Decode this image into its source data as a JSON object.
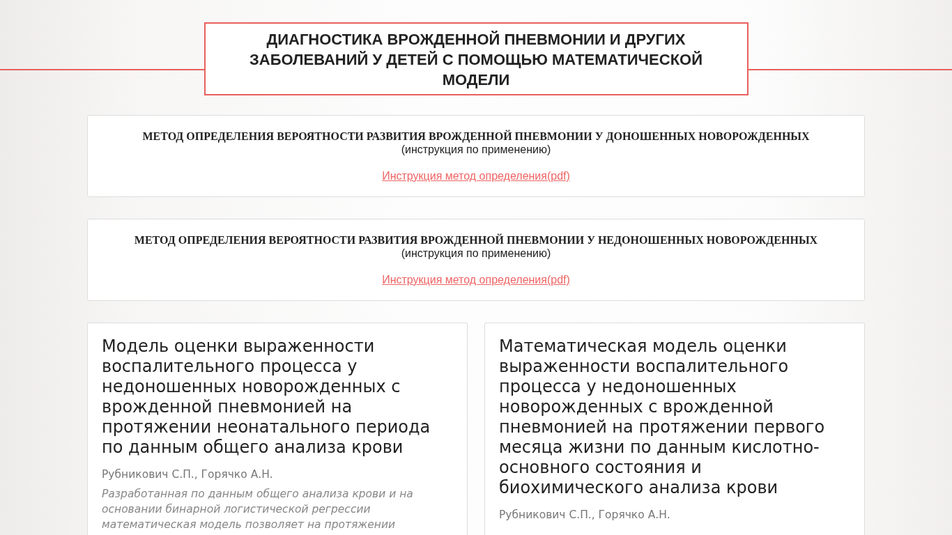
{
  "header": {
    "title": "ДИАГНОСТИКА ВРОЖДЕННОЙ ПНЕВМОНИИ И ДРУГИХ ЗАБОЛЕВАНИЙ У ДЕТЕЙ С ПОМОЩЬЮ МАТЕМАТИЧЕСКОЙ МОДЕЛИ"
  },
  "method_cards": [
    {
      "title": "МЕТОД ОПРЕДЕЛЕНИЯ ВЕРОЯТНОСТИ РАЗВИТИЯ ВРОЖДЕННОЙ ПНЕВМОНИИ У ДОНОШЕННЫХ НОВОРОЖДЕННЫХ",
      "subtitle": "(инструкция по применению)",
      "link": "Инструкция метод определения(pdf)"
    },
    {
      "title": "МЕТОД ОПРЕДЕЛЕНИЯ ВЕРОЯТНОСТИ РАЗВИТИЯ ВРОЖДЕННОЙ ПНЕВМОНИИ У НЕДОНОШЕННЫХ НОВОРОЖДЕННЫХ",
      "subtitle": "(инструкция по применению)",
      "link": "Инструкция метод определения(pdf)"
    }
  ],
  "model_cards": [
    {
      "title": "Модель оценки выраженности воспалительного процесса у недоношенных новорожденных с врожденной пневмонией на протяжении неонатального периода по данным общего анализа крови",
      "authors": "Рубникович С.П., Горячко А.Н.",
      "description": "Разработанная по данным общего анализа крови и на основании бинарной логистической регрессии математическая модель позволяет на протяжении"
    },
    {
      "title": "Математическая модель оценки выраженности воспалительного процесса у недоношенных новорожденных с врожденной пневмонией на протяжении первого месяца жизни по данным кислотно-основного состояния и биохимического анализа крови",
      "authors": "Рубникович С.П., Горячко А.Н."
    }
  ]
}
